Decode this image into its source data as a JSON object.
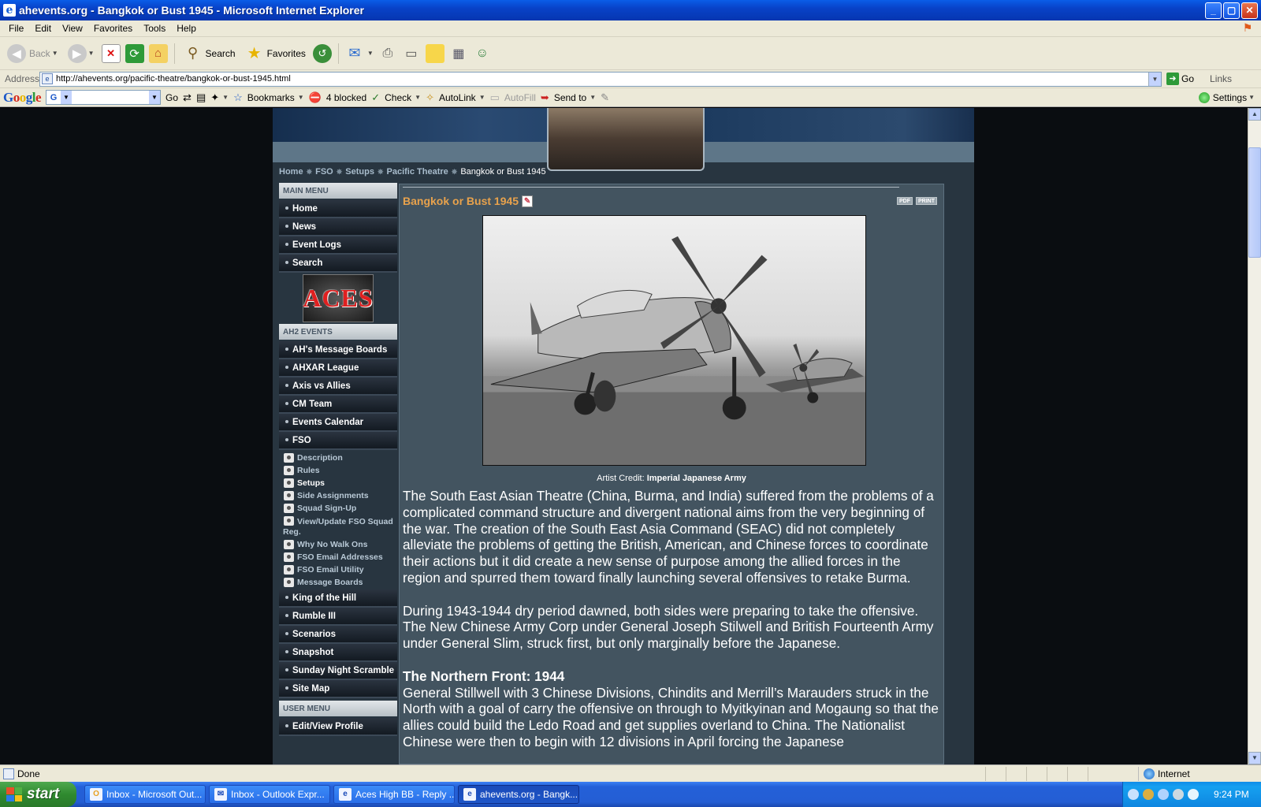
{
  "window": {
    "title": "ahevents.org - Bangkok or Bust 1945 - Microsoft Internet Explorer",
    "min": "_",
    "max": "▢",
    "close": "✕"
  },
  "menubar": [
    "File",
    "Edit",
    "View",
    "Favorites",
    "Tools",
    "Help"
  ],
  "toolbar": {
    "back": "Back",
    "search": "Search",
    "favorites": "Favorites"
  },
  "address": {
    "label": "Address",
    "url": "http://ahevents.org/pacific-theatre/bangkok-or-bust-1945.html",
    "go": "Go",
    "links": "Links"
  },
  "google_toolbar": {
    "logo": "Google",
    "go": "Go",
    "bookmarks": "Bookmarks",
    "blocked": "4 blocked",
    "check": "Check",
    "autolink": "AutoLink",
    "autofill": "AutoFill",
    "sendto": "Send to",
    "settings": "Settings"
  },
  "breadcrumb": {
    "items": [
      "Home",
      "FSO",
      "Setups",
      "Pacific Theatre"
    ],
    "current": "Bangkok or Bust 1945"
  },
  "left_menu": {
    "main_menu_title": "MAIN MENU",
    "main_items": [
      "Home",
      "News",
      "Event Logs",
      "Search"
    ],
    "logo_text": "ACES",
    "events_title": "AH2 EVENTS",
    "events_items": [
      "AH's Message Boards",
      "AHXAR League",
      "Axis vs Allies",
      "CM Team",
      "Events Calendar",
      "FSO"
    ],
    "fso_sub": [
      "Description",
      "Rules",
      "Setups",
      "Side Assignments",
      "Squad Sign-Up"
    ],
    "fso_sub_wrap": "View/Update FSO Squad",
    "fso_sub_wrap2": "Reg.",
    "fso_sub2": [
      "Why No Walk Ons",
      "FSO Email Addresses",
      "FSO Email Utility",
      "Message Boards"
    ],
    "events_items2": [
      "King of the Hill",
      "Rumble III",
      "Scenarios",
      "Snapshot",
      "Sunday Night Scramble",
      "Site Map"
    ],
    "user_menu_title": "USER MENU",
    "user_items": [
      "Edit/View Profile"
    ]
  },
  "article": {
    "title": "Bangkok or Bust 1945",
    "pdf": "PDF",
    "print": "PRINT",
    "caption_prefix": "Artist Credit: ",
    "caption_credit": "Imperial Japanese Army",
    "para1": "The South East Asian Theatre (China, Burma, and India) suffered from the problems of a complicated command structure and divergent national aims from the very beginning of the war. The creation of the South East Asia Command (SEAC) did not completely alleviate the problems of getting the British, American, and Chinese forces to coordinate their actions but it did create a new sense of purpose among the allied forces in the region and spurred them toward finally launching several offensives to retake Burma.",
    "para2": "During 1943-1944 dry period dawned, both sides were preparing to take the offensive. The New Chinese Army Corp under General Joseph Stilwell and British Fourteenth Army under General Slim, struck first, but only marginally before the Japanese.",
    "heading": "The Northern Front: 1944",
    "para3": "General Stillwell with 3 Chinese Divisions, Chindits and Merrill’s Marauders struck in the North with a goal of carry the offensive on through to Myitkyinan and Mogaung so that the allies could build the Ledo Road and get supplies overland to China. The Nationalist Chinese were then to begin with 12 divisions in April forcing the Japanese"
  },
  "statusbar": {
    "status": "Done",
    "zone": "Internet"
  },
  "taskbar": {
    "start": "start",
    "tasks": [
      "Inbox - Microsoft Out...",
      "Inbox - Outlook Expr...",
      "Aces High BB - Reply ...",
      "ahevents.org - Bangk..."
    ],
    "clock": "9:24 PM"
  }
}
